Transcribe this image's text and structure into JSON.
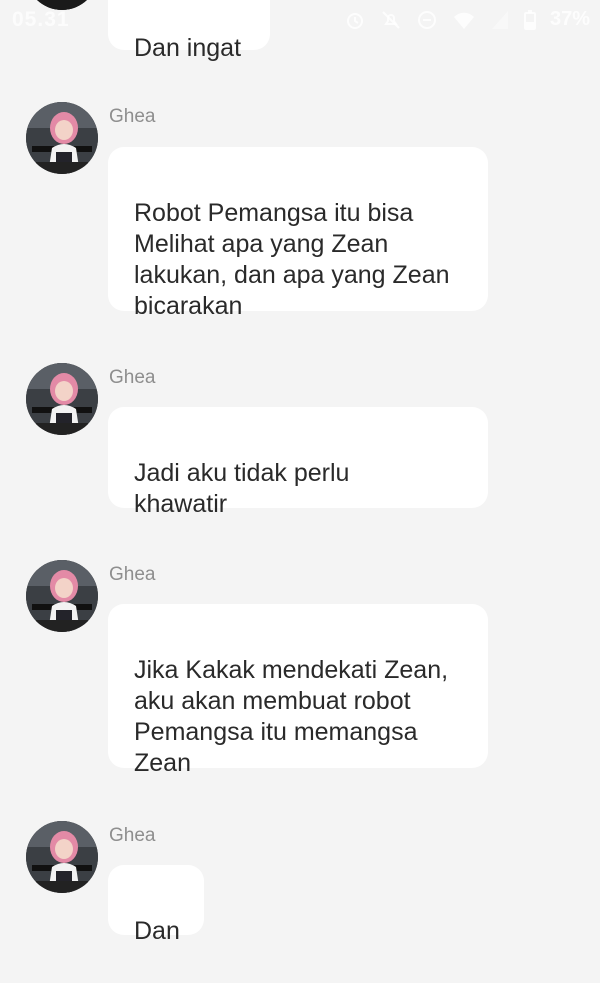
{
  "status_bar": {
    "time": "05.31",
    "battery": "37%",
    "icons": [
      "alarm-icon",
      "mute-icon",
      "dnd-icon",
      "wifi-icon",
      "signal-icon",
      "battery-icon"
    ]
  },
  "messages": [
    {
      "sender": "",
      "text": "Dan ingat",
      "show_avatar": false
    },
    {
      "sender": "Ghea",
      "text": "Robot Pemangsa itu bisa\nMelihat apa yang Zean\nlakukan, dan apa yang Zean\nbicarakan",
      "show_avatar": true
    },
    {
      "sender": "Ghea",
      "text": "Jadi aku tidak perlu\nkhawatir",
      "show_avatar": true
    },
    {
      "sender": "Ghea",
      "text": "Jika Kakak mendekati Zean,\naku akan membuat robot\nPemangsa itu memangsa\nZean",
      "show_avatar": true
    },
    {
      "sender": "Ghea",
      "text": "Dan",
      "show_avatar": true
    }
  ],
  "colors": {
    "background": "#f4f4f4",
    "bubble": "#ffffff",
    "sender_name": "#8e8e8e",
    "message_text": "#2a2a2a"
  }
}
